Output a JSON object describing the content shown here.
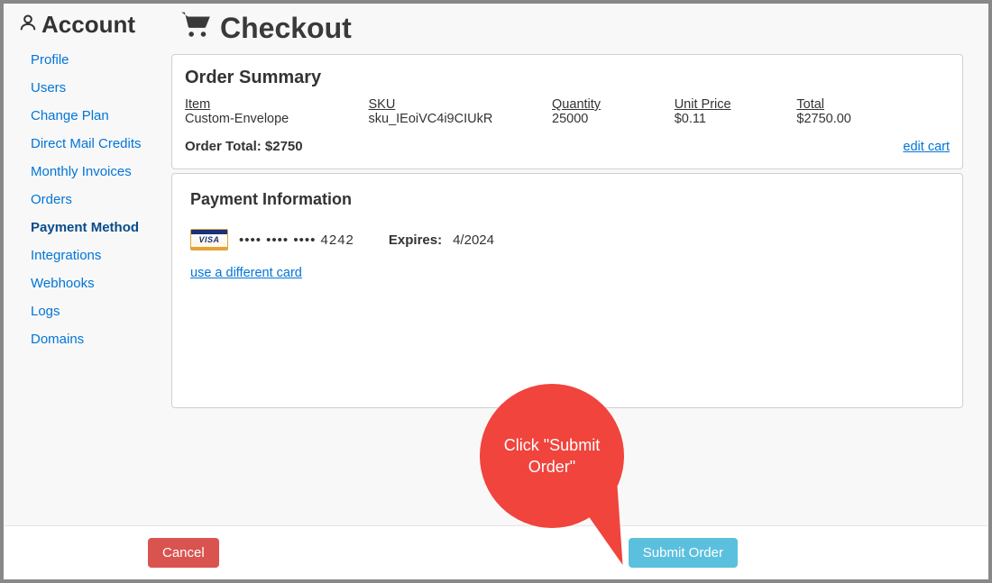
{
  "sidebar": {
    "title": "Account",
    "items": [
      {
        "label": "Profile"
      },
      {
        "label": "Users"
      },
      {
        "label": "Change Plan"
      },
      {
        "label": "Direct Mail Credits"
      },
      {
        "label": "Monthly Invoices"
      },
      {
        "label": "Orders"
      },
      {
        "label": "Payment Method"
      },
      {
        "label": "Integrations"
      },
      {
        "label": "Webhooks"
      },
      {
        "label": "Logs"
      },
      {
        "label": "Domains"
      }
    ]
  },
  "page": {
    "title": "Checkout"
  },
  "order_summary": {
    "title": "Order Summary",
    "headers": {
      "item": "Item",
      "sku": "SKU",
      "quantity": "Quantity",
      "unit_price": "Unit Price",
      "total": "Total"
    },
    "rows": [
      {
        "item": "Custom-Envelope",
        "sku": "sku_IEoiVC4i9CIUkR",
        "quantity": "25000",
        "unit_price": "$0.11",
        "total": "$2750.00"
      }
    ],
    "total_label": "Order Total: $2750",
    "edit_cart_label": "edit cart"
  },
  "payment": {
    "title": "Payment Information",
    "masked_number": "•••• •••• •••• 4242",
    "expires_label": "Expires:",
    "expires_value": "4/2024",
    "change_card_label": "use a different card",
    "brand_text": "VISA"
  },
  "footer": {
    "cancel_label": "Cancel",
    "submit_label": "Submit Order"
  },
  "annotation": {
    "text": "Click \"Submit Order\""
  }
}
